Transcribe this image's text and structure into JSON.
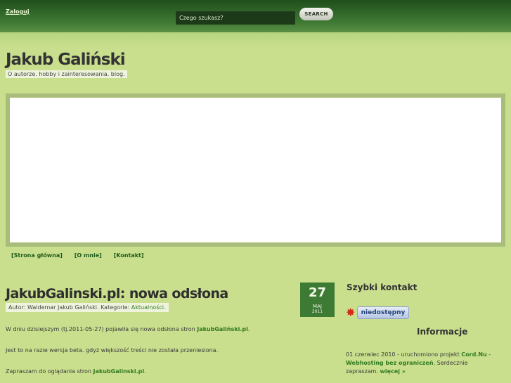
{
  "header": {
    "login_label": "Zaloguj",
    "search_placeholder": "Czego szukasz?",
    "search_button": "SEARCH"
  },
  "site": {
    "title": "Jakub Galiński",
    "tagline": "O autorze. hobby i zainteresowania. blog."
  },
  "nav": {
    "items": [
      "[Strona główna]",
      "[O mnie]",
      "[Kontakt]"
    ]
  },
  "post": {
    "title": "JakubGalinski.pl: nowa odsłona",
    "meta_prefix": "Autor: Waldemar Jakub Galiński. Kategorie: ",
    "category": "Aktualności",
    "meta_suffix": ".",
    "date": {
      "day": "27",
      "month": "MAJ",
      "year": "2011"
    },
    "p1_prefix": "W dniu dzisiejszym (tj.2011-05-27) pojawiła się nowa odsłona stron ",
    "p1_link": "JakubGaliński.pl",
    "p1_suffix": ".",
    "p2": "Jest to na razie wersja beta. gdyż większość treści nie została przeniesiona.",
    "p3_prefix": "Zapraszam do oglądania stron ",
    "p3_link": "JakubGalinski.pl",
    "p3_suffix": "."
  },
  "sidebar": {
    "quick_contact_title": "Szybki kontakt",
    "status_label": "niedostępny",
    "info_title": "Informacje",
    "info_prefix": "01 czerwiec 2010 - uruchomiono projekt ",
    "info_link1": "Cord.Nu",
    "info_dash": " - ",
    "info_link2": "Webhosting bez ograniczeń",
    "info_mid": ". Serdecznie zapraszam. ",
    "info_more": "więcej »"
  },
  "colors": {
    "accent": "#3d7a34",
    "background": "#c9df8d",
    "link": "#2f7a1f"
  },
  "icons": {
    "status": "star-burst-icon"
  }
}
